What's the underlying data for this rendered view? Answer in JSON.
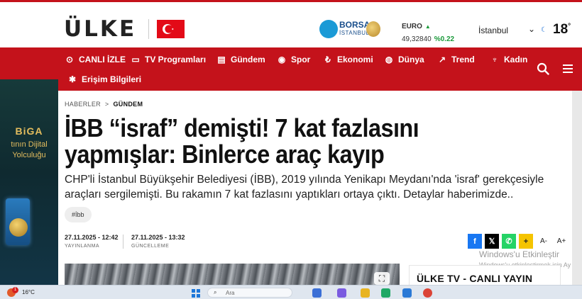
{
  "header": {
    "logo_text": "ÜLKE",
    "flag_name": "turkey-flag",
    "borsa": {
      "title": "BORSA",
      "subtitle": "İSTANBUL"
    },
    "currency": {
      "label": "EURO",
      "value": "49,32840",
      "change": "%0.22"
    },
    "city": "İstanbul",
    "temperature": "18",
    "degree": "°"
  },
  "nav": {
    "items": [
      {
        "label": "CANLI İZLE",
        "icon": "play-circle-icon"
      },
      {
        "label": "TV Programları",
        "icon": "tv-icon"
      },
      {
        "label": "Gündem",
        "icon": "newspaper-icon"
      },
      {
        "label": "Spor",
        "icon": "ball-icon"
      },
      {
        "label": "Ekonomi",
        "icon": "lira-icon"
      },
      {
        "label": "Dünya",
        "icon": "globe-icon"
      },
      {
        "label": "Trend",
        "icon": "trend-icon"
      },
      {
        "label": "Kadın",
        "icon": "hanger-icon"
      },
      {
        "label": "Erişim Bilgileri",
        "icon": "gear-icon"
      }
    ]
  },
  "ad": {
    "title": "BiGA",
    "line1": "tının Dijital",
    "line2": "Yolculuğu"
  },
  "article": {
    "breadcrumb": [
      "HABERLER",
      "GÜNDEM"
    ],
    "breadcrumb_sep": ">",
    "headline": "İBB “israf” demişti! 7 kat fazlasını yapmışlar: Binlerce araç kayıp",
    "summary": "CHP'li İstanbul Büyükşehir Belediyesi (İBB), 2019 yılında Yenikapı Meydanı'nda 'israf' gerekçesiyle araçları sergilemişti. Bu rakamın 7 kat fazlasını yaptıkları ortaya çıktı. Detaylar haberimizde..",
    "tag": "#İbb",
    "published": {
      "date": "27.11.2025 - 12:42",
      "label": "YAYINLANMA"
    },
    "updated": {
      "date": "27.11.2025 - 13:32",
      "label": "GÜNCELLEME"
    },
    "share": [
      {
        "name": "facebook",
        "glyph": "f",
        "color": "#1877f2"
      },
      {
        "name": "x",
        "glyph": "𝕏",
        "color": "#000000"
      },
      {
        "name": "whatsapp",
        "glyph": "✆",
        "color": "#25d366"
      },
      {
        "name": "add",
        "glyph": "+",
        "color": "#f5c400"
      }
    ],
    "font_decrease": "A-",
    "font_increase": "A+",
    "expand_glyph": "⛶"
  },
  "sidebar": {
    "tv_title": "ÜLKE TV - CANLI YAYIN"
  },
  "watermark": {
    "title": "Windows'u Etkinleştir",
    "subtitle": "Windows'u etkinleştirmek için Ay"
  },
  "taskbar": {
    "badge": "1",
    "temp": "16°C",
    "search_placeholder": "Ara"
  },
  "colors": {
    "brand_red": "#c4121b",
    "nav_text": "#ffffff",
    "positive": "#1a9a3a"
  }
}
